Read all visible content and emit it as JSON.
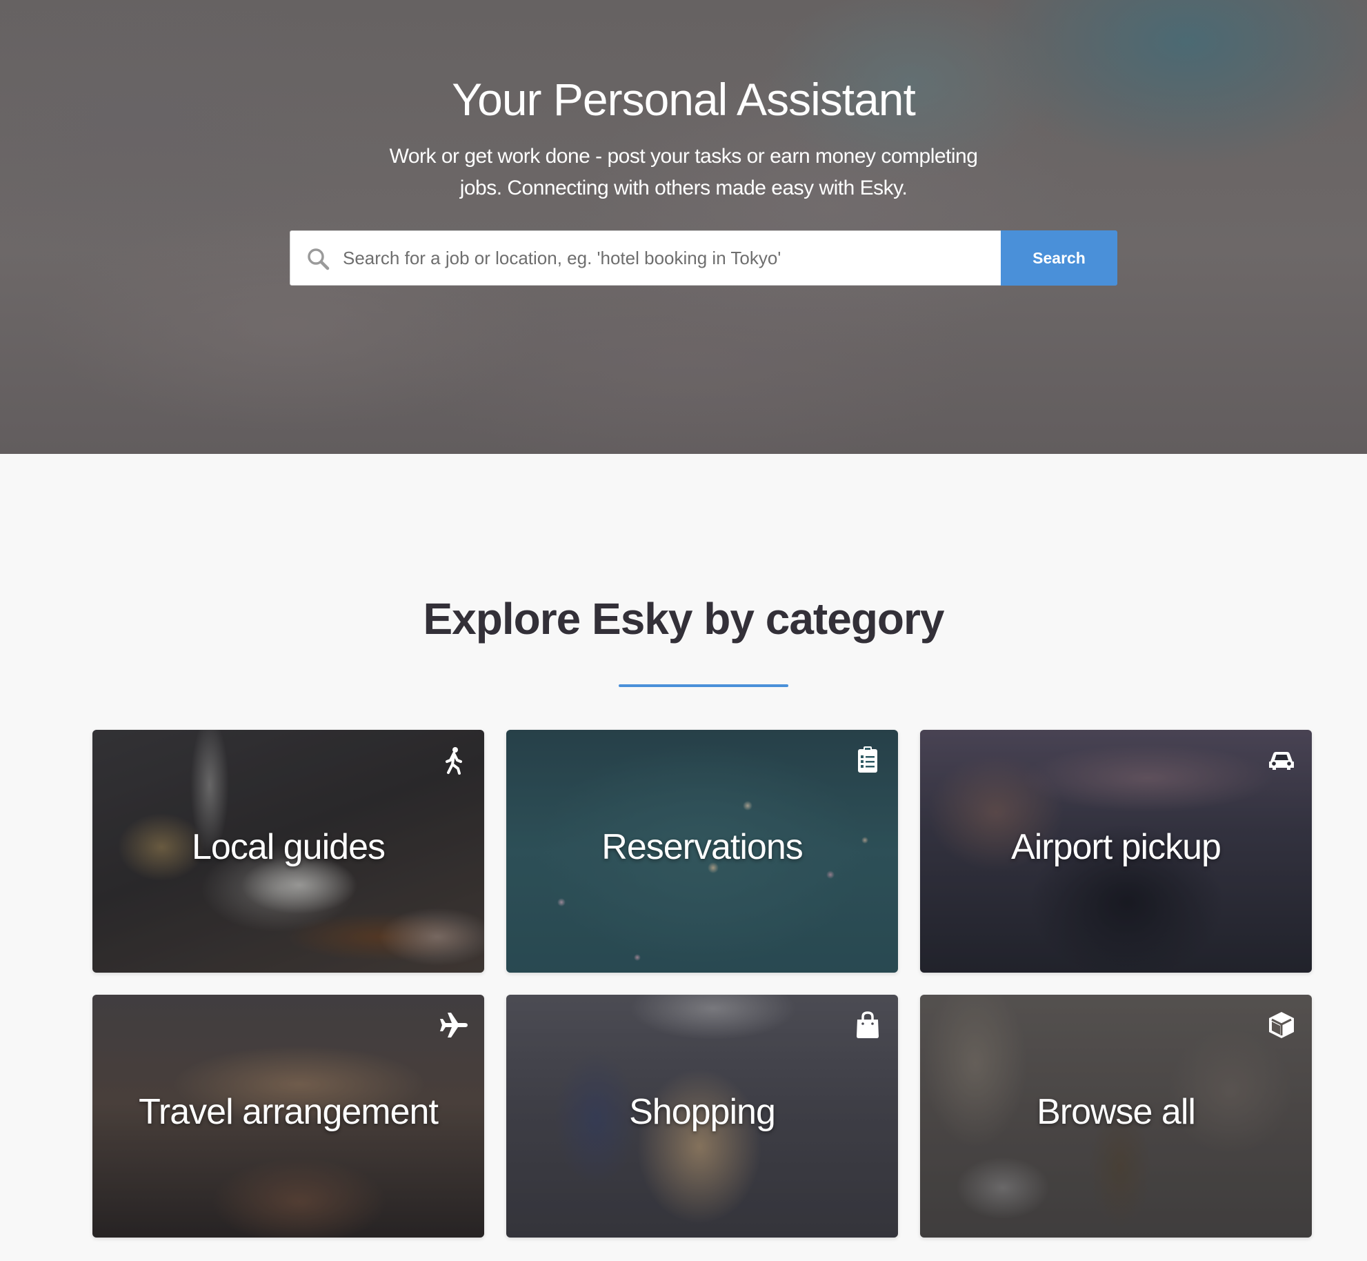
{
  "hero": {
    "title": "Your Personal Assistant",
    "subtitle_line1": "Work or get work done - post your tasks or earn money completing",
    "subtitle_line2": "jobs. Connecting with others made easy with Esky."
  },
  "search": {
    "placeholder": "Search for a job or location, eg. 'hotel booking in Tokyo'",
    "value": "",
    "button_label": "Search",
    "icon": "search-icon"
  },
  "categories_section": {
    "title": "Explore Esky by category",
    "accent_color": "#4a90d9",
    "cards": [
      {
        "label": "Local guides",
        "icon": "walking-person-icon"
      },
      {
        "label": "Reservations",
        "icon": "clipboard-list-icon"
      },
      {
        "label": "Airport pickup",
        "icon": "car-icon"
      },
      {
        "label": "Travel arrangement",
        "icon": "airplane-icon"
      },
      {
        "label": "Shopping",
        "icon": "shopping-bag-icon"
      },
      {
        "label": "Browse all",
        "icon": "cube-icon"
      }
    ]
  }
}
